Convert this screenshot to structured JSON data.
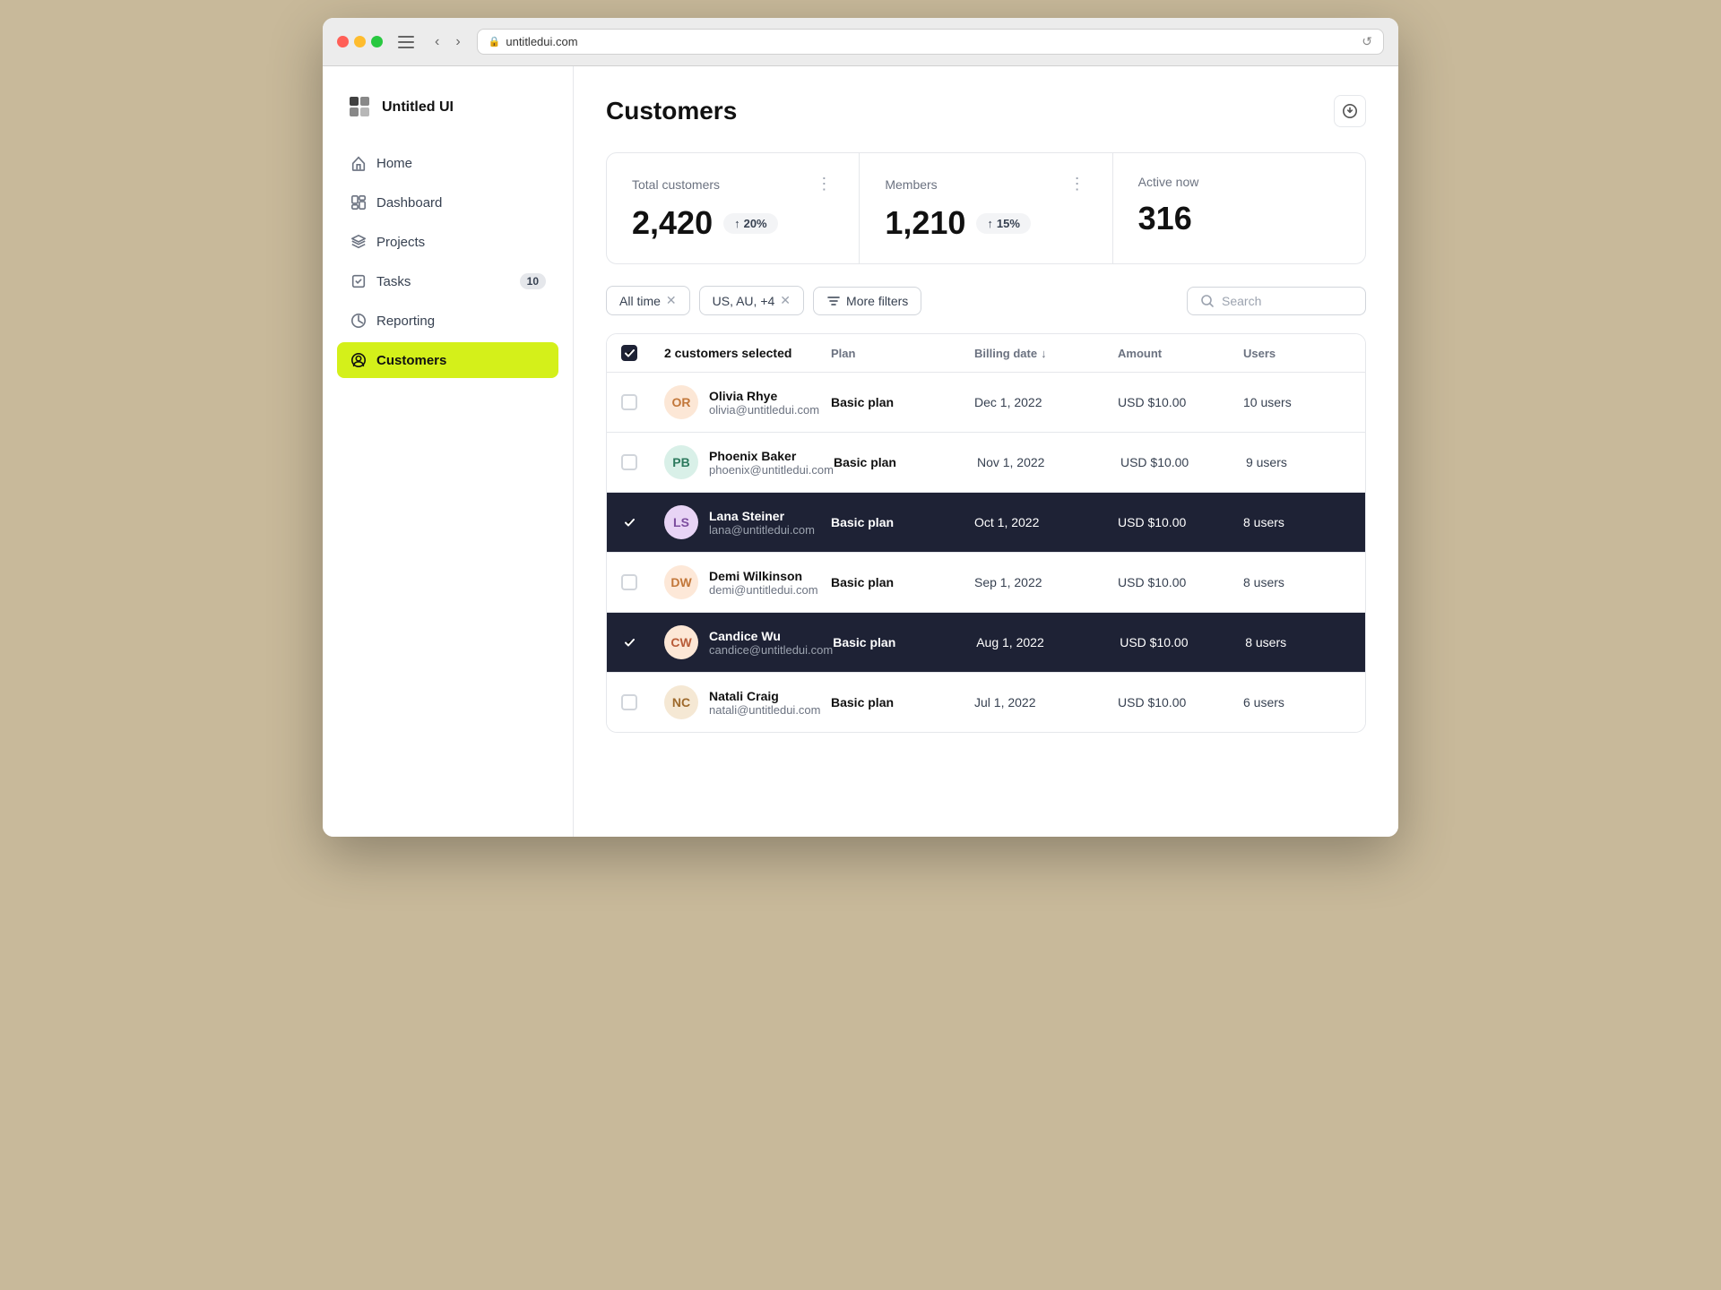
{
  "browser": {
    "url": "untitledui.com",
    "back_btn": "‹",
    "forward_btn": "›",
    "refresh_btn": "↺"
  },
  "logo": {
    "text": "Untitled UI",
    "icon": "grid-icon"
  },
  "nav": {
    "items": [
      {
        "id": "home",
        "label": "Home",
        "icon": "home-icon",
        "badge": null,
        "active": false
      },
      {
        "id": "dashboard",
        "label": "Dashboard",
        "icon": "dashboard-icon",
        "badge": null,
        "active": false
      },
      {
        "id": "projects",
        "label": "Projects",
        "icon": "layers-icon",
        "badge": null,
        "active": false
      },
      {
        "id": "tasks",
        "label": "Tasks",
        "icon": "tasks-icon",
        "badge": "10",
        "active": false
      },
      {
        "id": "reporting",
        "label": "Reporting",
        "icon": "reporting-icon",
        "badge": null,
        "active": false
      },
      {
        "id": "customers",
        "label": "Customers",
        "icon": "customers-icon",
        "badge": null,
        "active": true
      }
    ]
  },
  "page": {
    "title": "Customers",
    "download_tooltip": "Download"
  },
  "stats": [
    {
      "label": "Total customers",
      "value": "2,420",
      "badge": "20%",
      "trend": "up"
    },
    {
      "label": "Members",
      "value": "1,210",
      "badge": "15%",
      "trend": "up"
    },
    {
      "label": "Active now",
      "value": "316",
      "badge": null,
      "trend": null
    }
  ],
  "filters": {
    "all_time": "All time",
    "location": "US, AU, +4",
    "more_filters": "More filters"
  },
  "search": {
    "placeholder": "Search"
  },
  "table": {
    "header": {
      "name_col": "",
      "plan_col": "Plan",
      "billing_col": "Billing date",
      "amount_col": "Amount",
      "users_col": "Users"
    },
    "selected_count": "2 customers selected",
    "rows": [
      {
        "id": "olivia",
        "name": "Olivia Rhye",
        "email": "olivia@untitledui.com",
        "plan": "Basic plan",
        "billing_date": "Dec 1, 2022",
        "amount": "USD $10.00",
        "users": "10 users",
        "selected": false,
        "initials": "OR",
        "av_class": "av-olivia"
      },
      {
        "id": "phoenix",
        "name": "Phoenix Baker",
        "email": "phoenix@untitledui.com",
        "plan": "Basic plan",
        "billing_date": "Nov 1, 2022",
        "amount": "USD $10.00",
        "users": "9 users",
        "selected": false,
        "initials": "PB",
        "av_class": "av-phoenix"
      },
      {
        "id": "lana",
        "name": "Lana Steiner",
        "email": "lana@untitledui.com",
        "plan": "Basic plan",
        "billing_date": "Oct 1, 2022",
        "amount": "USD $10.00",
        "users": "8 users",
        "selected": true,
        "initials": "LS",
        "av_class": "av-lana"
      },
      {
        "id": "demi",
        "name": "Demi Wilkinson",
        "email": "demi@untitledui.com",
        "plan": "Basic plan",
        "billing_date": "Sep 1, 2022",
        "amount": "USD $10.00",
        "users": "8 users",
        "selected": false,
        "initials": "DW",
        "av_class": "av-demi"
      },
      {
        "id": "candice",
        "name": "Candice Wu",
        "email": "candice@untitledui.com",
        "plan": "Basic plan",
        "billing_date": "Aug 1, 2022",
        "amount": "USD $10.00",
        "users": "8 users",
        "selected": true,
        "initials": "CW",
        "av_class": "av-candice"
      },
      {
        "id": "natali",
        "name": "Natali Craig",
        "email": "natali@untitledui.com",
        "plan": "Basic plan",
        "billing_date": "Jul 1, 2022",
        "amount": "USD $10.00",
        "users": "6 users",
        "selected": false,
        "initials": "NC",
        "av_class": "av-natali"
      }
    ]
  },
  "colors": {
    "active_nav_bg": "#d4f01a",
    "selected_row_bg": "#1e2235"
  }
}
